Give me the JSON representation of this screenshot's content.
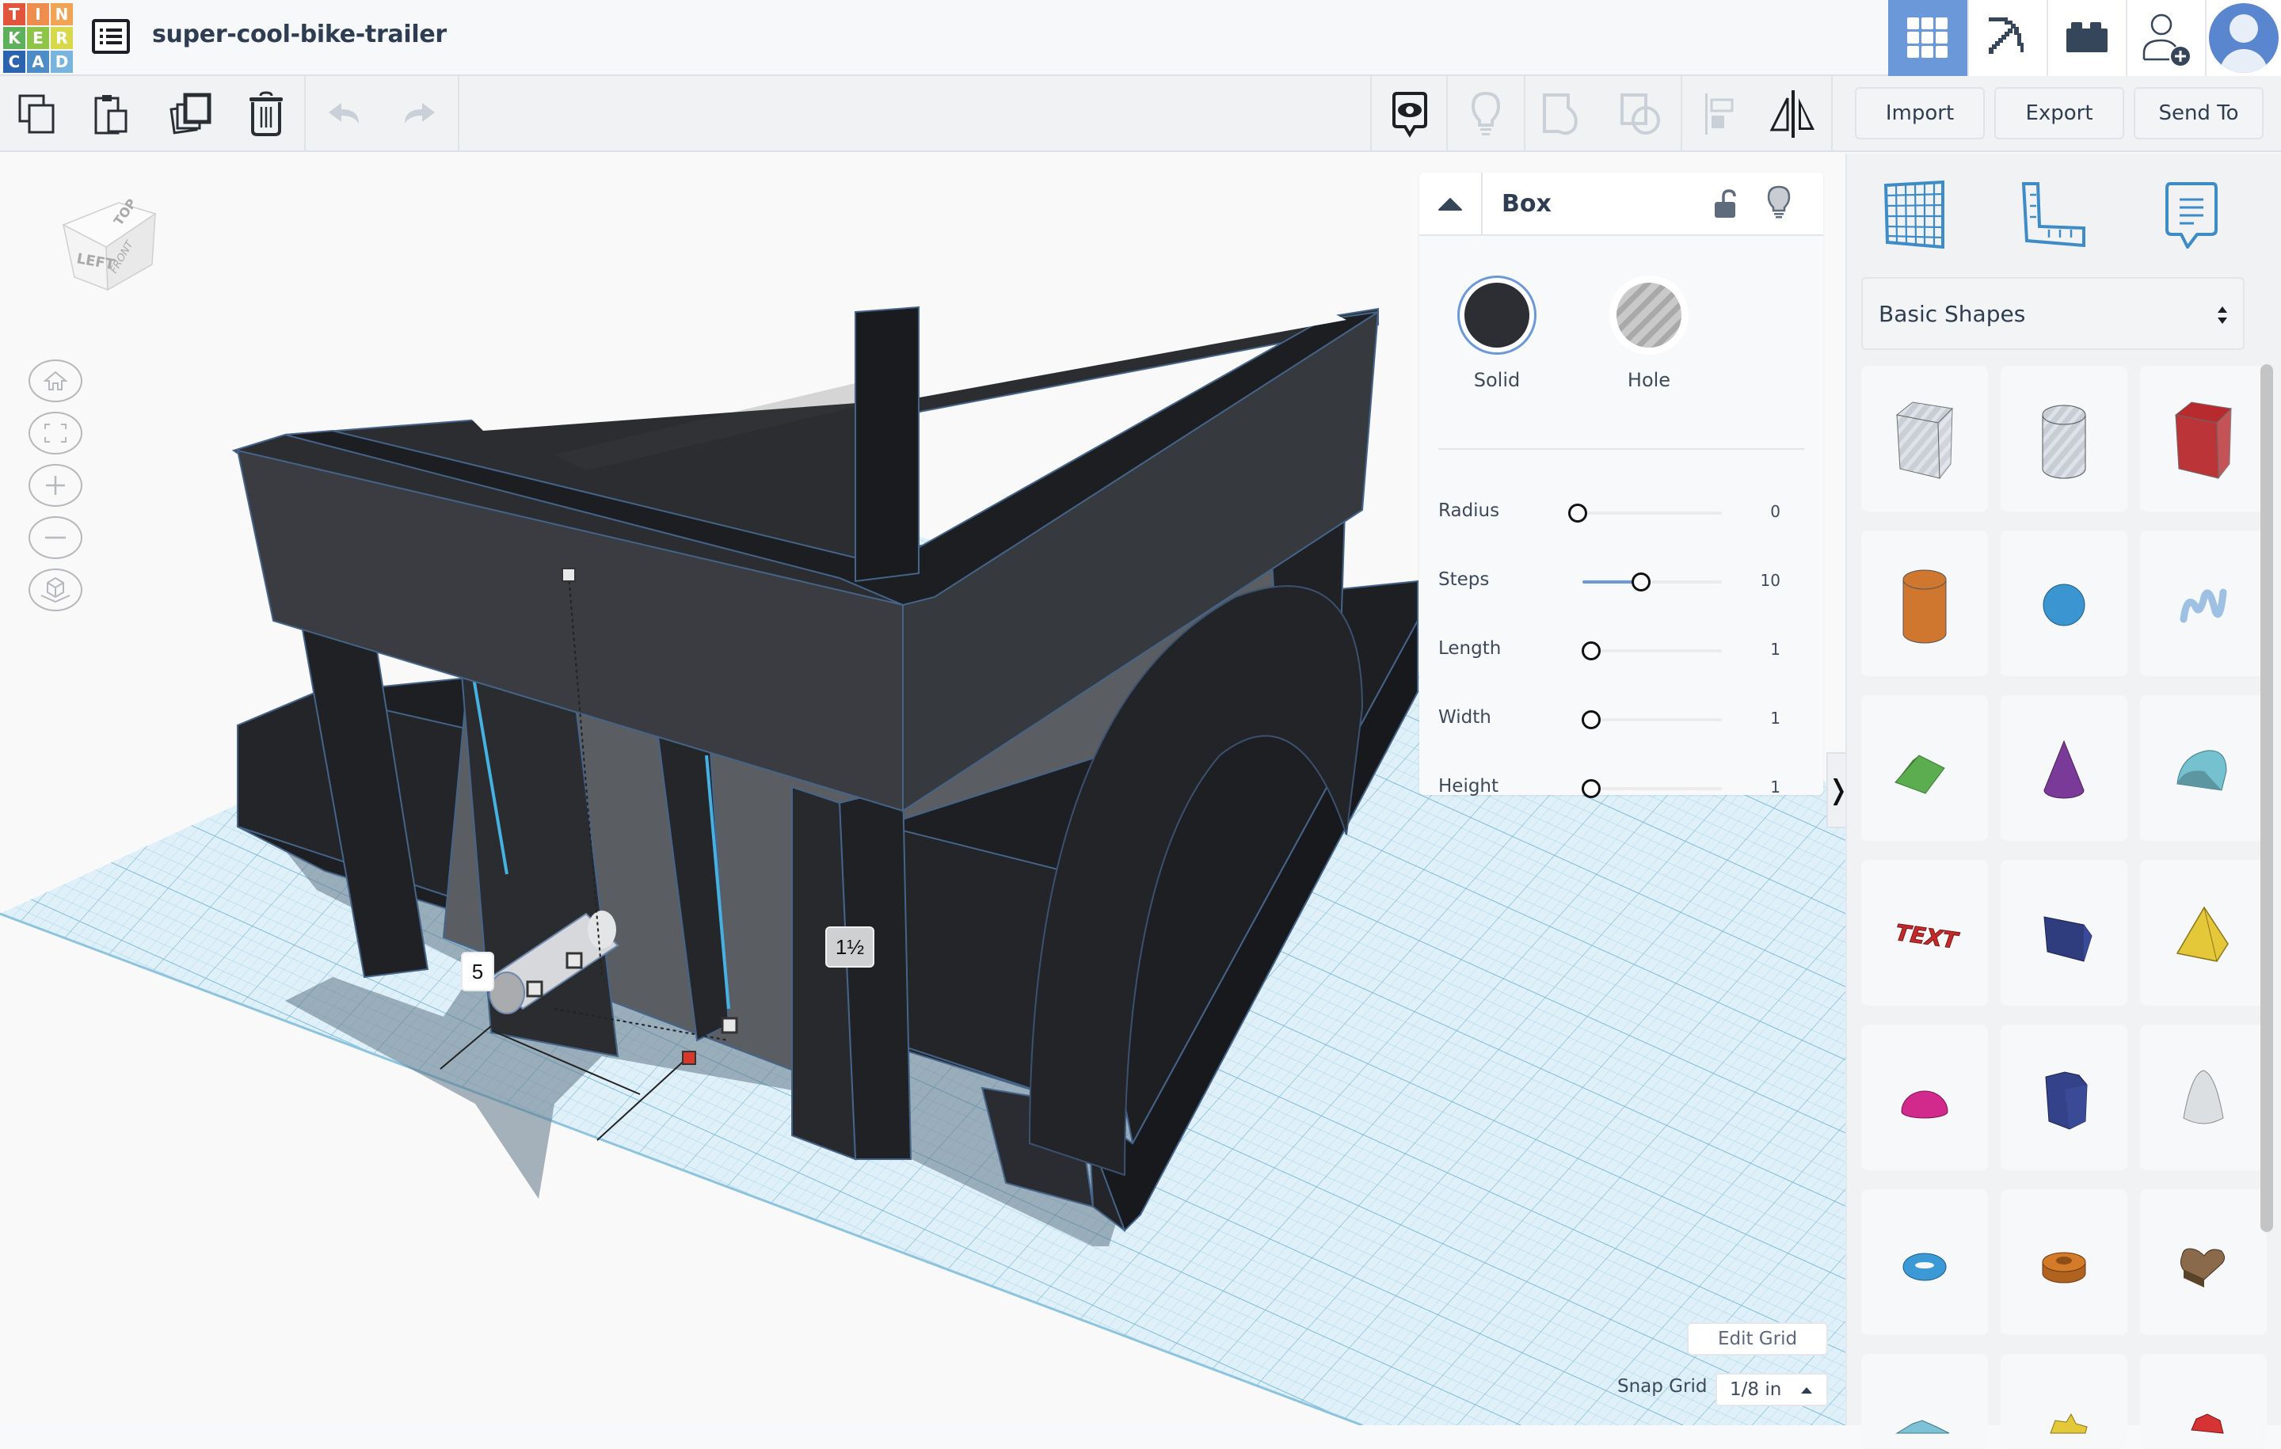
{
  "app": {
    "logo_letters": [
      "T",
      "I",
      "N",
      "K",
      "E",
      "R",
      "C",
      "A",
      "D"
    ],
    "logo_colors": [
      "#e2543b",
      "#ee8e4e",
      "#f2a455",
      "#5fb05a",
      "#8ec548",
      "#d7d94a",
      "#2c63b0",
      "#4c8dc8",
      "#78b4de"
    ],
    "document_title": "super-cool-bike-trailer"
  },
  "topbar_right": {
    "items": [
      {
        "name": "3d-design-view",
        "icon": "grid-icon",
        "active": true
      },
      {
        "name": "blocks-view",
        "icon": "pickaxe-icon",
        "active": false
      },
      {
        "name": "bricks-view",
        "icon": "brick-icon",
        "active": false
      },
      {
        "name": "invite-user",
        "icon": "add-user-icon",
        "active": false
      }
    ],
    "avatar_icon": "user-avatar-icon"
  },
  "toolbar": {
    "left_tools": [
      {
        "name": "copy",
        "icon": "copy-icon",
        "enabled": true
      },
      {
        "name": "paste",
        "icon": "paste-icon",
        "enabled": true
      },
      {
        "name": "duplicate",
        "icon": "duplicate-icon",
        "enabled": true
      },
      {
        "name": "delete",
        "icon": "trash-icon",
        "enabled": true
      },
      {
        "name": "undo",
        "icon": "undo-icon",
        "enabled": false
      },
      {
        "name": "redo",
        "icon": "redo-icon",
        "enabled": false
      }
    ],
    "right_tools": [
      {
        "name": "show-all",
        "icon": "eye-bubble-icon",
        "enabled": true
      },
      {
        "name": "notes",
        "icon": "lightbulb-icon",
        "enabled": false
      },
      {
        "name": "group",
        "icon": "group-icon",
        "enabled": false
      },
      {
        "name": "ungroup",
        "icon": "ungroup-icon",
        "enabled": false
      },
      {
        "name": "align",
        "icon": "align-icon",
        "enabled": false
      },
      {
        "name": "mirror",
        "icon": "mirror-icon",
        "enabled": true
      }
    ],
    "import_label": "Import",
    "export_label": "Export",
    "send_to_label": "Send To"
  },
  "viewcube": {
    "top": "TOP",
    "left": "LEFT",
    "front": "FRONT"
  },
  "nav_buttons": [
    {
      "name": "home-view",
      "icon": "home-icon"
    },
    {
      "name": "fit-view",
      "icon": "fit-icon"
    },
    {
      "name": "zoom-in",
      "icon": "plus-icon"
    },
    {
      "name": "zoom-out",
      "icon": "minus-icon"
    },
    {
      "name": "perspective",
      "icon": "perspective-cube-icon"
    }
  ],
  "measurements": {
    "length_label": "5",
    "height_label": "1½"
  },
  "inspector": {
    "shape_name": "Box",
    "modes": [
      {
        "label": "Solid",
        "selected": true,
        "color": "#2d2e33"
      },
      {
        "label": "Hole",
        "selected": false,
        "color": "#c9c9c9"
      }
    ],
    "params": [
      {
        "label": "Radius",
        "value": "0",
        "fraction": 0.0,
        "filled": false
      },
      {
        "label": "Steps",
        "value": "10",
        "fraction": 0.42,
        "filled": true
      },
      {
        "label": "Length",
        "value": "1",
        "fraction": 0.06,
        "filled": true
      },
      {
        "label": "Width",
        "value": "1",
        "fraction": 0.06,
        "filled": true
      },
      {
        "label": "Height",
        "value": "1",
        "fraction": 0.06,
        "filled": true
      }
    ],
    "collapse_chevron": "❭"
  },
  "grid": {
    "edit_grid_label": "Edit Grid",
    "snap_grid_label": "Snap Grid",
    "snap_grid_value": "1/8 in"
  },
  "right_panel": {
    "tabs": [
      {
        "name": "workplane",
        "icon": "workplane-grid-icon"
      },
      {
        "name": "ruler",
        "icon": "ruler-icon"
      },
      {
        "name": "notes",
        "icon": "note-bubble-icon"
      }
    ],
    "category": "Basic Shapes",
    "shapes": [
      {
        "name": "Box Hole",
        "color": "#c8ccd4",
        "kind": "box",
        "striped": true
      },
      {
        "name": "Cylinder Hole",
        "color": "#c8ccd4",
        "kind": "cylinder",
        "striped": true
      },
      {
        "name": "Box",
        "color": "#b72a2e",
        "kind": "box",
        "striped": false
      },
      {
        "name": "Cylinder",
        "color": "#cf772f",
        "kind": "cylinder",
        "striped": false
      },
      {
        "name": "Sphere",
        "color": "#3a95d0",
        "kind": "sphere",
        "striped": false
      },
      {
        "name": "Scribble",
        "color": "#9ec1e3",
        "kind": "scribble",
        "striped": false
      },
      {
        "name": "Roof",
        "color": "#5cad4f",
        "kind": "roof",
        "striped": false
      },
      {
        "name": "Cone",
        "color": "#7a3a98",
        "kind": "cone",
        "striped": false
      },
      {
        "name": "Round Roof",
        "color": "#76c1cf",
        "kind": "roundroof",
        "striped": false
      },
      {
        "name": "Text",
        "color": "#c42a2a",
        "kind": "text",
        "striped": false
      },
      {
        "name": "Wedge",
        "color": "#2f3d7e",
        "kind": "wedge",
        "striped": false
      },
      {
        "name": "Pyramid",
        "color": "#e4c83a",
        "kind": "pyramid",
        "striped": false
      },
      {
        "name": "Half Sphere",
        "color": "#d12a8c",
        "kind": "halfsphere",
        "striped": false
      },
      {
        "name": "Polygon",
        "color": "#34428a",
        "kind": "polygon",
        "striped": false
      },
      {
        "name": "Paraboloid",
        "color": "#dcdfe2",
        "kind": "paraboloid",
        "striped": false
      },
      {
        "name": "Torus",
        "color": "#3b9ad6",
        "kind": "torus",
        "striped": false
      },
      {
        "name": "Tube",
        "color": "#d47b2a",
        "kind": "tube",
        "striped": false
      },
      {
        "name": "Heart",
        "color": "#8a6a4a",
        "kind": "heart",
        "striped": false
      },
      {
        "name": "Star (partial)",
        "color": "#7cc1d6",
        "kind": "star6",
        "striped": false
      },
      {
        "name": "Star",
        "color": "#e3c83a",
        "kind": "star",
        "striped": false
      },
      {
        "name": "Icosahedron",
        "color": "#d63434",
        "kind": "ico",
        "striped": false
      }
    ]
  }
}
